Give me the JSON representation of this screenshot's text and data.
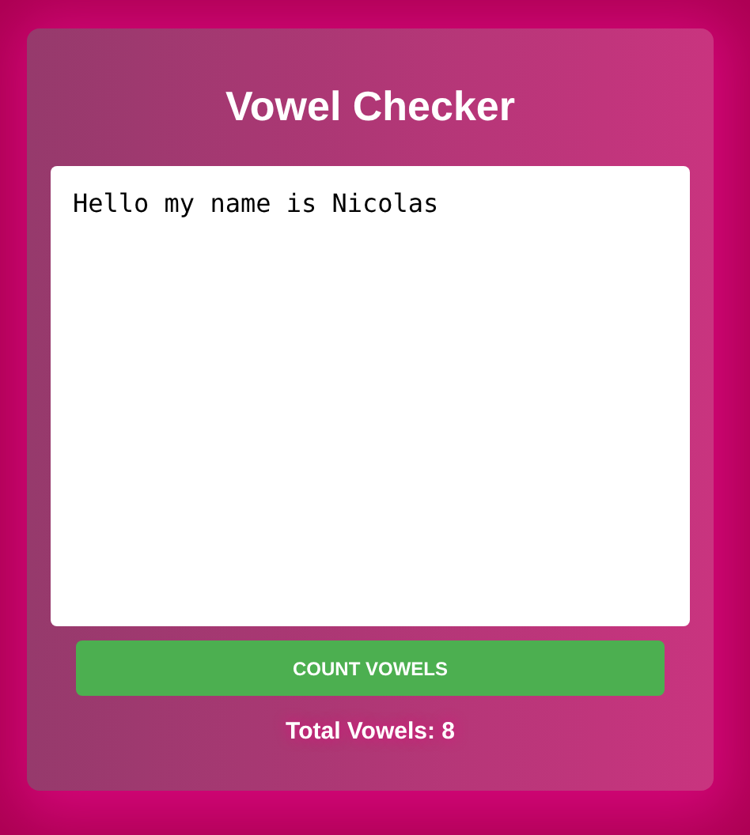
{
  "title": "Vowel Checker",
  "input": {
    "value": "Hello my name is Nicolas"
  },
  "button": {
    "label": "COUNT VOWELS"
  },
  "result": "Total Vowels: 8"
}
